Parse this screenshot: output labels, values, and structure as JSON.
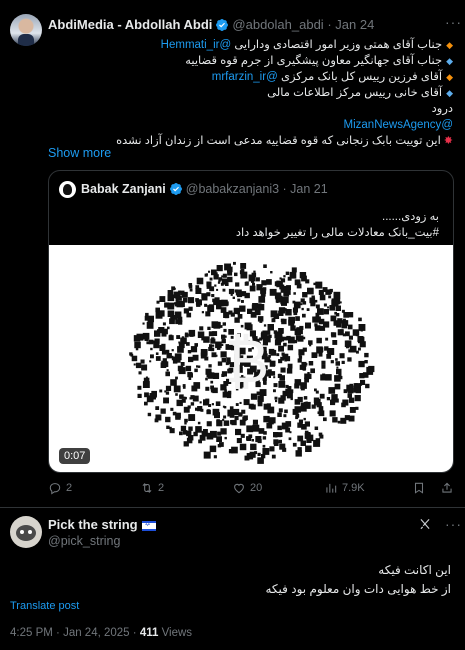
{
  "post": {
    "author_name": "AbdiMedia - Abdollah Abdi",
    "handle": "@abdolah_abdi",
    "date": "Jan 24",
    "lines": [
      {
        "bullet": "orange",
        "text": "جناب آقای همتی وزیر امور اقتصادی ودارایی ",
        "link": "@Hemmati_ir"
      },
      {
        "bullet": "blue",
        "text": "جناب آقای جهانگیر معاون پیشگیری از جرم قوه قضاییه",
        "link": ""
      },
      {
        "bullet": "orange",
        "text": "آقای فرزین رییس کل بانک مرکزی ",
        "link": "@mrfarzin_ir"
      },
      {
        "bullet": "blue",
        "text": "آقای خانی رییس مرکز اطلاعات مالی",
        "link": ""
      }
    ],
    "greeting": "درود",
    "mention": "@MizanNewsAgency",
    "last_line": "این توییت بابک زنجانی که قوه قضاییه مدعی است از زندان آزاد نشده",
    "show_more": "Show more"
  },
  "quote": {
    "author_name": "Babak Zanjani",
    "handle": "@babakzanjani3",
    "date": "Jan 21",
    "line1": "به زودی......",
    "line2": "#بیت_بانک معادلات مالی را تغییر خواهد داد",
    "video_duration": "0:07"
  },
  "actions": {
    "replies": "2",
    "reposts": "2",
    "likes": "20",
    "views": "7.9K"
  },
  "reply": {
    "author_name": "Pick the string",
    "handle": "@pick_string",
    "line1": "این اکانت فیکه",
    "line2": "از خط هوایی دات وان معلوم بود فیکه",
    "translate": "Translate post",
    "time": "4:25 PM",
    "date": "Jan 24, 2025",
    "views_count": "411",
    "views_label": "Views"
  },
  "colors": {
    "background": "#000000",
    "accent": "#1d9bf0",
    "muted": "#71767b",
    "border": "#2f3336"
  }
}
